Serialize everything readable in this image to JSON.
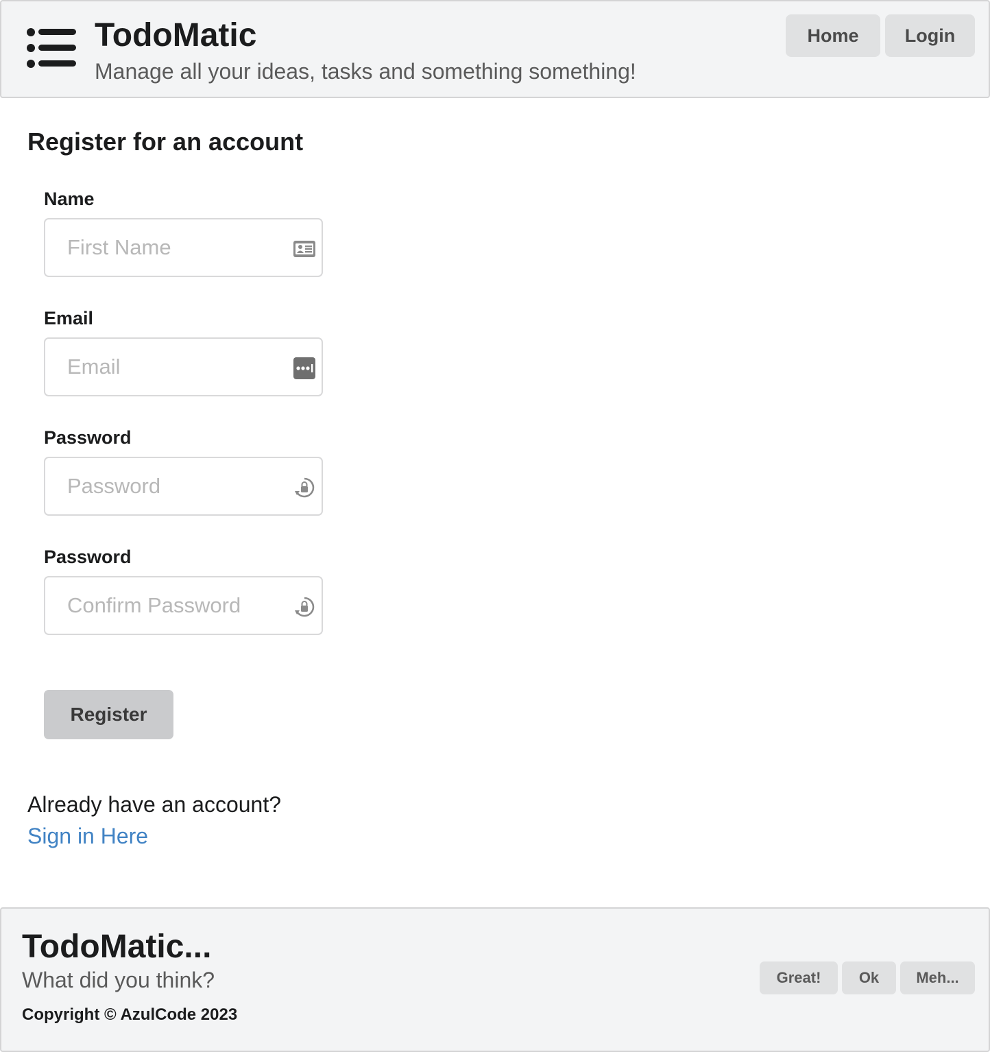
{
  "header": {
    "title": "TodoMatic",
    "subtitle": "Manage all your ideas, tasks and something something!",
    "nav": {
      "home_label": "Home",
      "login_label": "Login"
    },
    "menu_icon": "list-icon"
  },
  "form": {
    "heading": "Register for an account",
    "fields": {
      "name": {
        "label": "Name",
        "placeholder": "First Name",
        "value": "",
        "icon": "id-card-icon"
      },
      "email": {
        "label": "Email",
        "placeholder": "Email",
        "value": "",
        "icon": "password-manager-icon"
      },
      "password": {
        "label": "Password",
        "placeholder": "Password",
        "value": "",
        "icon": "lock-refresh-icon"
      },
      "confirm": {
        "label": "Password",
        "placeholder": "Confirm Password",
        "value": "",
        "icon": "lock-refresh-icon"
      }
    },
    "register_label": "Register"
  },
  "signin": {
    "prompt": "Already have an account?",
    "link_text": "Sign in Here"
  },
  "footer": {
    "title": "TodoMatic...",
    "subtitle": "What did you think?",
    "copyright": "Copyright © AzulCode 2023",
    "feedback": {
      "great_label": "Great!",
      "ok_label": "Ok",
      "meh_label": "Meh..."
    }
  },
  "colors": {
    "header_bg": "#f3f4f5",
    "button_bg": "#e0e1e2",
    "register_bg": "#cacbcd",
    "link": "#4183c4",
    "border": "#d4d4d5"
  }
}
